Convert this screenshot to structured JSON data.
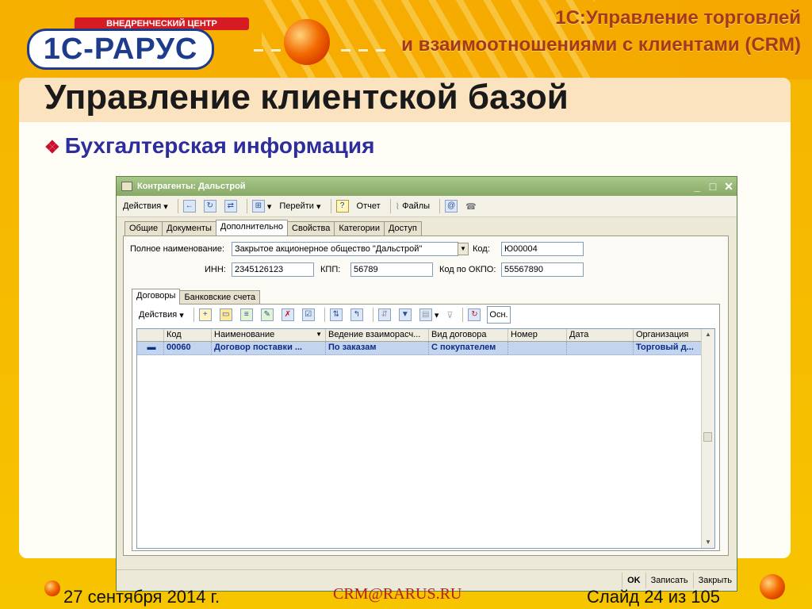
{
  "header": {
    "logo_top": "ВНЕДРЕНЧЕСКИЙ ЦЕНТР",
    "logo_main": "1С-РАРУС",
    "product_line1": "1С:Управление торговлей",
    "product_line2": "и взаимоотношениями с клиентами (CRM)"
  },
  "slide": {
    "title": "Управление клиентской базой",
    "bullet": "Бухгалтерская информация"
  },
  "window": {
    "title": "Контрагенты: Дальстрой",
    "toolbar": {
      "actions": "Действия",
      "goto": "Перейти",
      "report": "Отчет",
      "files": "Файлы"
    },
    "tabs": [
      "Общие",
      "Документы",
      "Дополнительно",
      "Свойства",
      "Категории",
      "Доступ"
    ],
    "form": {
      "full_name_label": "Полное наименование:",
      "full_name_value": "Закрытое акционерное общество \"Дальстрой\"",
      "code_label": "Код:",
      "code_value": "Ю00004",
      "inn_label": "ИНН:",
      "inn_value": "2345126123",
      "kpp_label": "КПП:",
      "kpp_value": "56789",
      "okpo_label": "Код по ОКПО:",
      "okpo_value": "55567890"
    },
    "subtabs": [
      "Договоры",
      "Банковские счета"
    ],
    "subtoolbar": {
      "actions": "Действия",
      "osn": "Осн."
    },
    "table": {
      "columns": [
        "Код",
        "Наименование",
        "Ведение взаиморасч...",
        "Вид договора",
        "Номер",
        "Дата",
        "Организация"
      ],
      "rows": [
        [
          "00060",
          "Договор поставки ...",
          "По заказам",
          "С покупателем",
          "",
          "",
          "Торговый д..."
        ]
      ]
    },
    "buttons": {
      "ok": "OK",
      "save": "Записать",
      "close": "Закрыть"
    }
  },
  "footer": {
    "date": "27 сентября 2014 г.",
    "email": "CRM@RARUS.RU",
    "slide_no": "Слайд 24 из  105"
  }
}
